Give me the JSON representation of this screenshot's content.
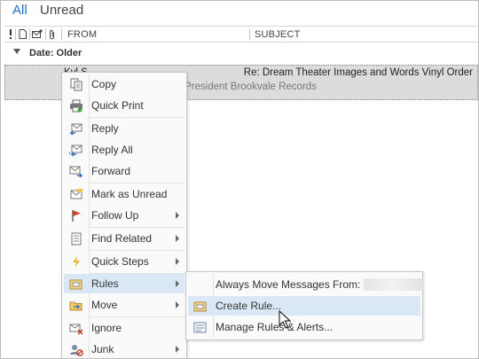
{
  "filter_tabs": {
    "all": "All",
    "unread": "Unread"
  },
  "columns": {
    "from": "FROM",
    "subject": "SUBJECT"
  },
  "group": {
    "label": "Date: Older"
  },
  "email": {
    "from": "Kyl S",
    "subject": "Re: Dream Theater Images and Words Vinyl Order",
    "preview": "President  Brookvale Records"
  },
  "context_menu": {
    "copy": "Copy",
    "quick_print": "Quick Print",
    "reply": "Reply",
    "reply_all": "Reply All",
    "forward": "Forward",
    "mark_unread": "Mark as Unread",
    "follow_up": "Follow Up",
    "find_related": "Find Related",
    "quick_steps": "Quick Steps",
    "rules": "Rules",
    "move": "Move",
    "ignore": "Ignore",
    "junk": "Junk"
  },
  "rules_submenu": {
    "always_move": "Always Move Messages From:",
    "create_rule": "Create Rule...",
    "manage_rules": "Manage Rules & Alerts..."
  },
  "colors": {
    "accent": "#1e6fc5",
    "highlight": "#dae8f6",
    "selected_row": "#dcdcdc"
  }
}
